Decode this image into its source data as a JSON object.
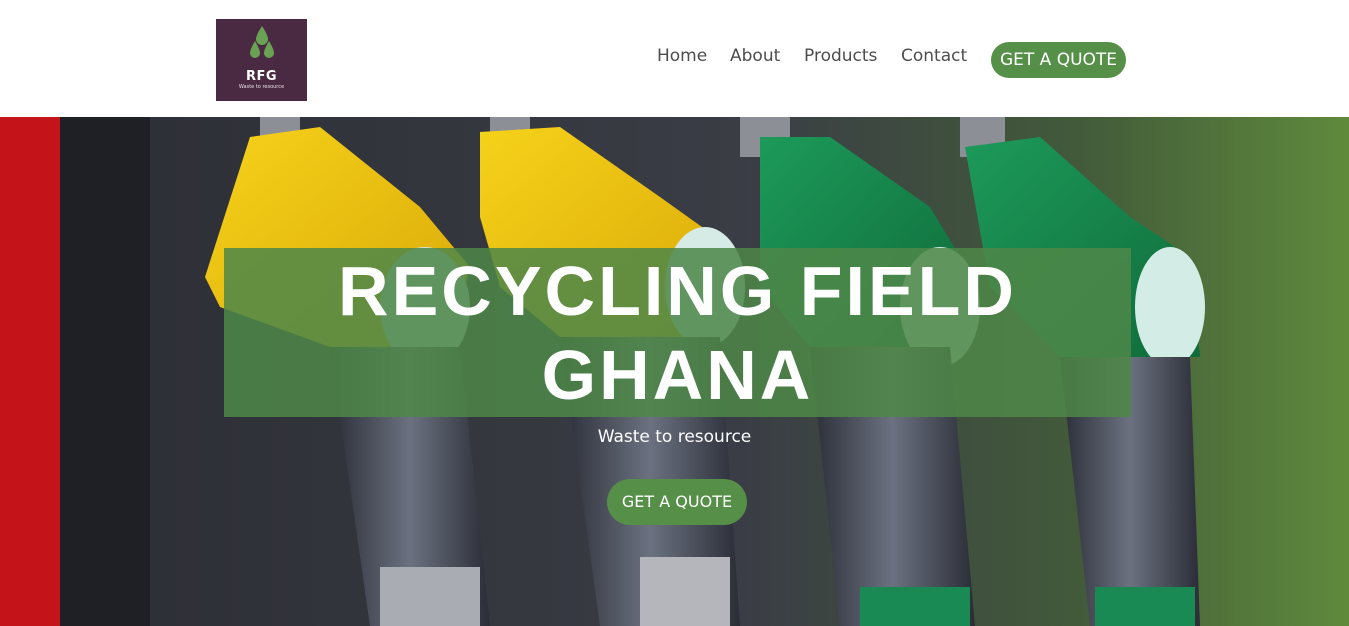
{
  "brand": {
    "logo_text": "RFG",
    "logo_tagline": "Waste to resource",
    "colors": {
      "logo_bg": "#4a2a42",
      "drop": "#6aa255",
      "accent": "#568f48"
    }
  },
  "nav": {
    "items": [
      {
        "label": "Home"
      },
      {
        "label": "About"
      },
      {
        "label": "Products"
      },
      {
        "label": "Contact"
      }
    ],
    "cta_label": "GET A QUOTE"
  },
  "hero": {
    "title_line1": "RECYCLING FIELD",
    "title_line2": "GHANA",
    "subtitle": "Waste to resource",
    "cta_label": "GET A QUOTE",
    "background": "fuel-pump-nozzles-photo"
  }
}
